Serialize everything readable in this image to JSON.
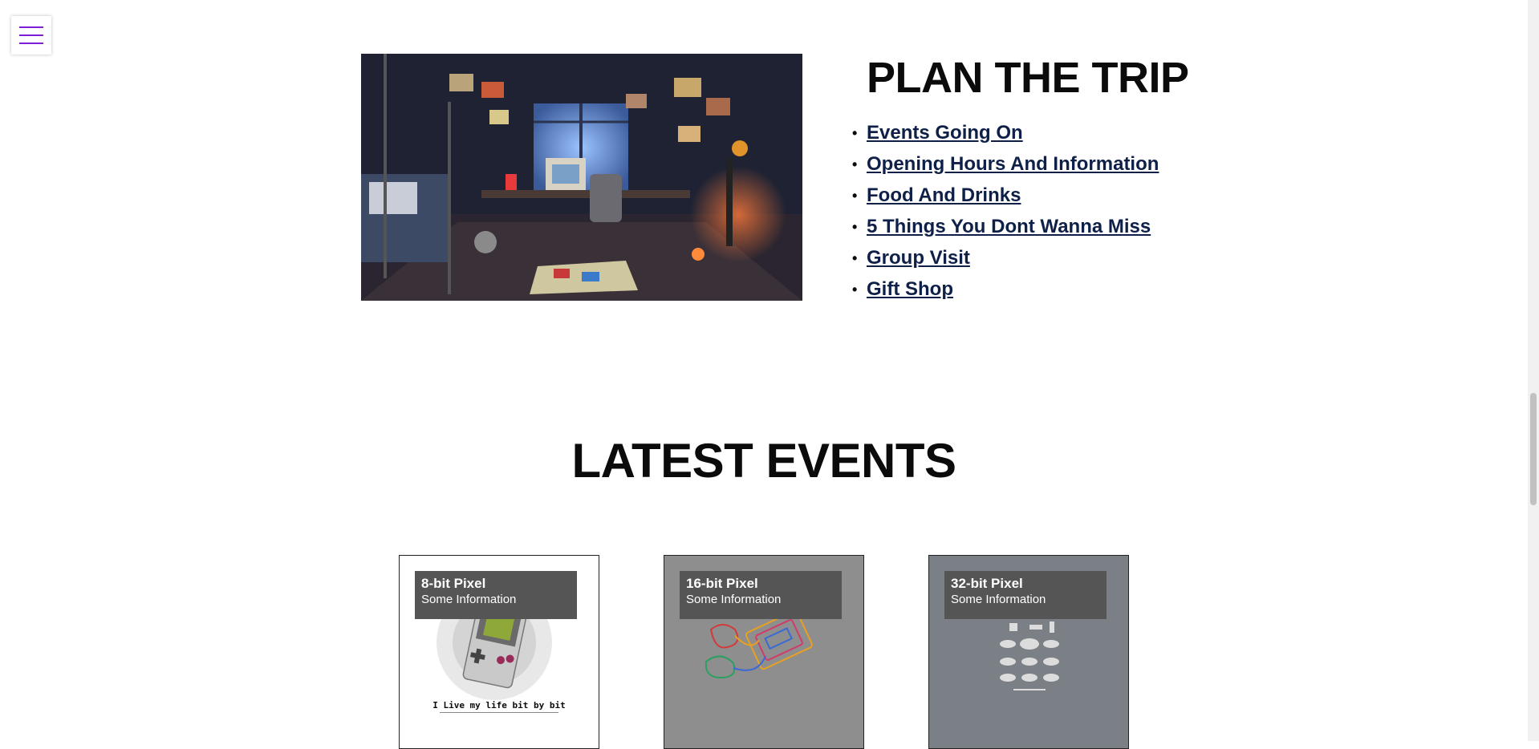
{
  "nav": {
    "menu_icon": "hamburger-icon",
    "accent": "#7a1fd6"
  },
  "plan": {
    "title": "PLAN THE TRIP",
    "links": [
      "Events Going On",
      "Opening Hours And Information",
      "Food And Drinks",
      "5 Things You Dont Wanna Miss",
      "Group Visit",
      "Gift Shop"
    ],
    "link_color": "#0f2048"
  },
  "events": {
    "title": "LATEST EVENTS",
    "cards": [
      {
        "title": "8-bit Pixel",
        "subtitle": "Some Information",
        "image_text": "I Live my life bit by bit"
      },
      {
        "title": "16-bit Pixel",
        "subtitle": "Some Information"
      },
      {
        "title": "32-bit Pixel",
        "subtitle": "Some Information"
      }
    ]
  }
}
